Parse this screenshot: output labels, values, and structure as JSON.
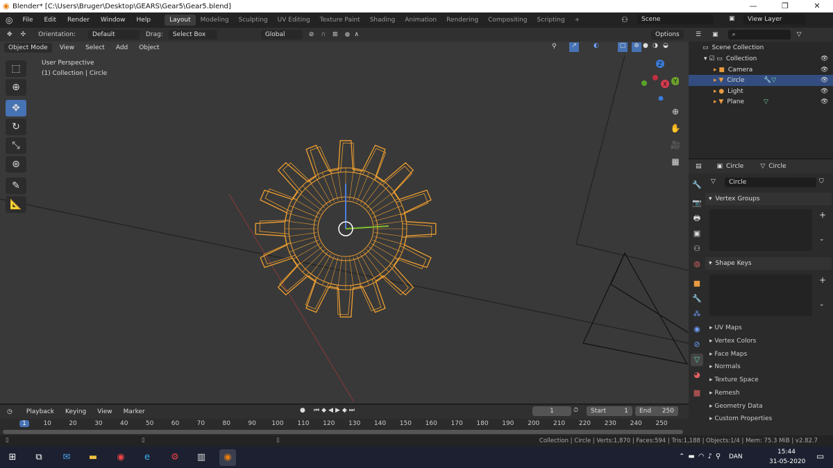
{
  "window": {
    "title": "Blender* [C:\\Users\\Bruger\\Desktop\\GEARS\\Gear5\\Gear5.blend]",
    "minimize": "—",
    "maximize": "❐",
    "close": "✕"
  },
  "menu": [
    "File",
    "Edit",
    "Render",
    "Window",
    "Help"
  ],
  "workspaces": [
    "Layout",
    "Modeling",
    "Sculpting",
    "UV Editing",
    "Texture Paint",
    "Shading",
    "Animation",
    "Rendering",
    "Compositing",
    "Scripting",
    "+"
  ],
  "scene": {
    "scene_name": "Scene",
    "view_layer": "View Layer"
  },
  "tool_header": {
    "orientation_label": "Orientation:",
    "orientation_value": "Default",
    "drag_label": "Drag:",
    "drag_value": "Select Box",
    "transform_orientation": "Global",
    "options": "Options"
  },
  "viewport_header": {
    "mode": "Object Mode",
    "view": "View",
    "select": "Select",
    "add": "Add",
    "object": "Object"
  },
  "viewport": {
    "perspective": "User Perspective",
    "context": "(1) Collection | Circle",
    "gizmo": {
      "z": "Z",
      "y": "Y",
      "x": "X"
    },
    "accent": "#4772b3",
    "selection_color": "#f0a030"
  },
  "outliner": {
    "root": "Scene Collection",
    "items": [
      {
        "label": "Collection",
        "level": 1
      },
      {
        "label": "Camera",
        "level": 2
      },
      {
        "label": "Circle",
        "level": 2,
        "selected": true
      },
      {
        "label": "Light",
        "level": 2
      },
      {
        "label": "Plane",
        "level": 2
      }
    ]
  },
  "properties": {
    "object": "Circle",
    "mesh": "Circle",
    "mesh_name_field": "Circle",
    "panels_open": [
      "Vertex Groups",
      "Shape Keys"
    ],
    "panels_closed": [
      "UV Maps",
      "Vertex Colors",
      "Face Maps",
      "Normals",
      "Texture Space",
      "Remesh",
      "Geometry Data",
      "Custom Properties"
    ]
  },
  "timeline": {
    "menus": [
      "Playback",
      "Keying",
      "View",
      "Marker"
    ],
    "current_frame": "1",
    "start_label": "Start",
    "start": "1",
    "end_label": "End",
    "end": "250",
    "ticks": [
      1,
      10,
      20,
      30,
      40,
      50,
      60,
      70,
      80,
      90,
      100,
      110,
      120,
      130,
      140,
      150,
      160,
      170,
      180,
      190,
      200,
      210,
      220,
      230,
      240,
      250
    ]
  },
  "status": "Collection | Circle | Verts:1,870 | Faces:594 | Tris:1,188 | Objects:1/4 | Mem: 75.3 MiB | v2.82.7",
  "taskbar": {
    "lang": "DAN",
    "time": "15:44",
    "date": "31-05-2020"
  }
}
